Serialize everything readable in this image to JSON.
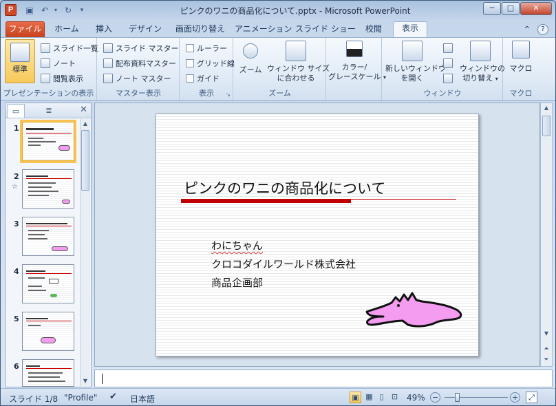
{
  "app": {
    "icon_letter": "P",
    "title": "ピンクのワニの商品化について.pptx - Microsoft PowerPoint",
    "window_controls": {
      "minimize": "─",
      "maximize": "□",
      "close": "✕"
    }
  },
  "quick_access": {
    "save_icon": "save-icon",
    "undo_icon": "undo-icon",
    "redo_icon": "redo-icon",
    "customize_icon": "customize-qat-icon"
  },
  "tabs": {
    "file": "ファイル",
    "items": [
      "ホーム",
      "挿入",
      "デザイン",
      "画面切り替え",
      "アニメーション",
      "スライド ショー",
      "校閲",
      "表示"
    ],
    "active": "表示",
    "help_symbols": [
      "^",
      "?"
    ]
  },
  "ribbon": {
    "presentation_views": {
      "label": "プレゼンテーションの表示",
      "normal": "標準",
      "slide_sorter": "スライド一覧",
      "notes_page": "ノート",
      "reading_view": "閲覧表示"
    },
    "master_views": {
      "label": "マスター表示",
      "slide_master": "スライド マスター",
      "handout_master": "配布資料マスター",
      "notes_master": "ノート マスター"
    },
    "show": {
      "label": "表示",
      "ruler": "ルーラー",
      "gridlines": "グリッド線",
      "guides": "ガイド"
    },
    "zoom": {
      "label": "ズーム",
      "zoom": "ズーム",
      "fit_window_1": "ウィンドウ サイズ",
      "fit_window_2": "に合わせる"
    },
    "color": {
      "line1": "カラー/",
      "line2": "グレースケール"
    },
    "window": {
      "label": "ウィンドウ",
      "new_window_1": "新しいウィンドウ",
      "new_window_2": "を開く",
      "switch_1": "ウィンドウの",
      "switch_2": "切り替え"
    },
    "macros": {
      "label": "マクロ",
      "macros": "マクロ"
    }
  },
  "thumbnails": {
    "numbers": [
      "1",
      "2",
      "3",
      "4",
      "5",
      "6"
    ],
    "selected": "1"
  },
  "slide": {
    "title": "ピンクのワニの商品化について",
    "subtitle_lines": [
      "わにちゃん",
      "クロコダイルワールド株式会社",
      "商品企画部"
    ],
    "accent_color": "#c00000",
    "mascot_color": "#f49cf0"
  },
  "status": {
    "slide_indicator": "スライド 1/8",
    "theme": "\"Profile\"",
    "language": "日本語",
    "zoom": "49%"
  }
}
